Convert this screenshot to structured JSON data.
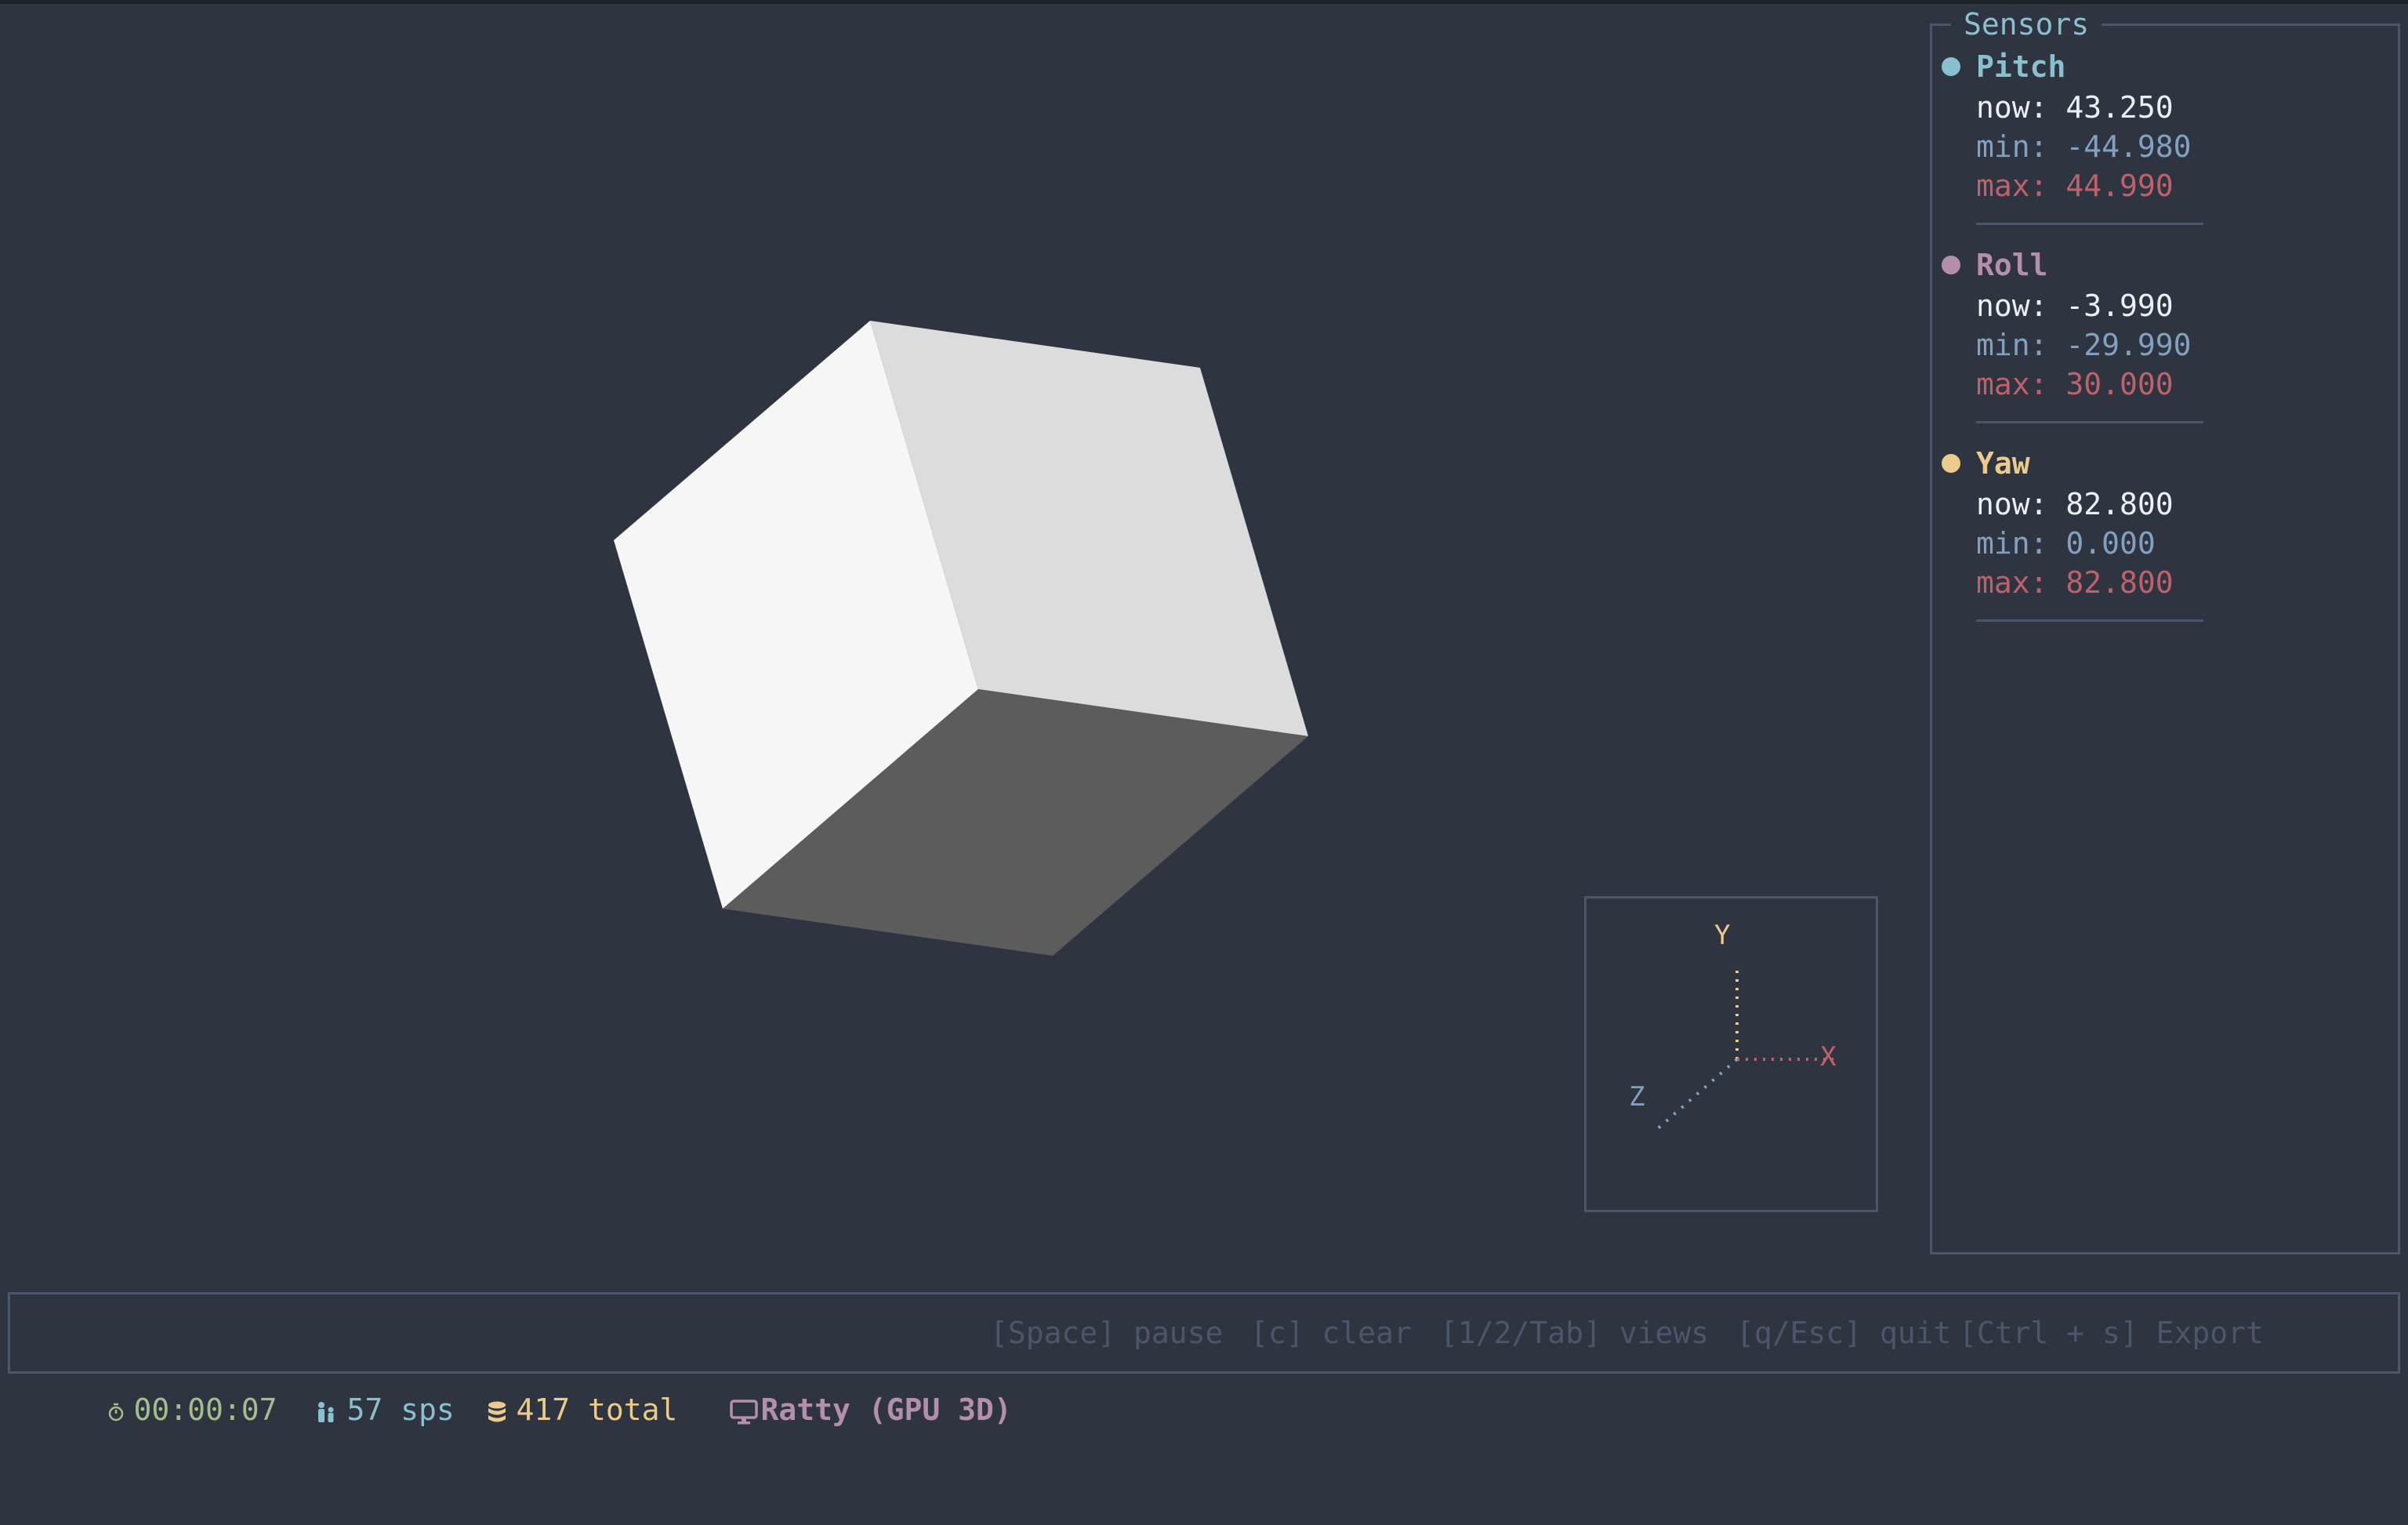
{
  "colors": {
    "background": "#2e3440",
    "border": "#4c566a",
    "pitch": "#88c0d0",
    "roll": "#b48ead",
    "yaw": "#ebcb8b",
    "min_value": "#81a1c1",
    "max_value": "#bf616a",
    "now_value": "#eceff4",
    "time": "#a3be8c",
    "rate": "#88c0d0",
    "total": "#ebcb8b",
    "view": "#b48ead",
    "help": "#4c566a"
  },
  "gizmo": {
    "y_label": "Y",
    "x_label": "X",
    "z_label": "Z"
  },
  "sensors": {
    "title": "Sensors",
    "items": [
      {
        "name": "Pitch",
        "now": "now: 43.250",
        "min": "min: -44.980",
        "max": "max: 44.990"
      },
      {
        "name": "Roll",
        "now": "now: -3.990",
        "min": "min: -29.990",
        "max": "max: 30.000"
      },
      {
        "name": "Yaw",
        "now": "now: 82.800",
        "min": "min: 0.000",
        "max": "max: 82.800"
      }
    ]
  },
  "statusbar": {
    "time": "00:00:07",
    "rate": "57 sps",
    "total": "417 total",
    "view": "Ratty (GPU 3D)",
    "help_pause": "[Space] pause",
    "help_clear": "[c] clear",
    "help_views": "[1/2/Tab] views",
    "help_quit": "[q/Esc] quit",
    "help_export": "[Ctrl + s] Export",
    "icons": {
      "time": "stopwatch-icon",
      "rate": "people-icon",
      "total": "database-icon",
      "view": "monitor-icon"
    }
  }
}
